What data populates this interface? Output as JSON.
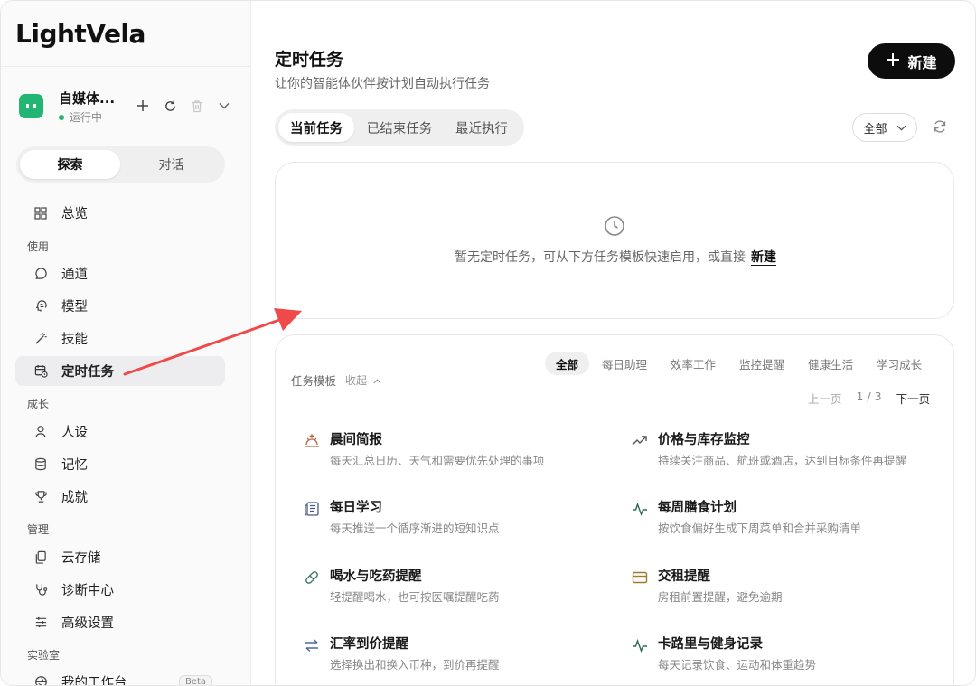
{
  "app": {
    "logo": "LightVela"
  },
  "agent": {
    "name": "自媒体...",
    "status": "运行中",
    "actions": [
      "plus-icon",
      "refresh-icon",
      "trash-icon",
      "chevron-down-icon"
    ]
  },
  "mode_switch": {
    "active": "探索",
    "inactive": "对话"
  },
  "sidebar": {
    "overview": "总览",
    "sections": {
      "use": "使用",
      "grow": "成长",
      "manage": "管理",
      "lab": "实验室"
    },
    "items": {
      "channel": "通道",
      "model": "模型",
      "skills": "技能",
      "scheduled": "定时任务",
      "persona": "人设",
      "memory": "记忆",
      "achievement": "成就",
      "cloud": "云存储",
      "diagnosis": "诊断中心",
      "advanced": "高级设置",
      "workbench": "我的工作台",
      "beta": "Beta"
    }
  },
  "main": {
    "title": "定时任务",
    "subtitle": "让你的智能体伙伴按计划自动执行任务",
    "new_button": "新建",
    "tabs": [
      "当前任务",
      "已结束任务",
      "最近执行"
    ],
    "filter": "全部",
    "empty": {
      "text": "暂无定时任务，可从下方任务模板快速启用，或直接",
      "link": "新建"
    },
    "templates": {
      "label": "任务模板",
      "collapse": "收起",
      "categories": [
        "全部",
        "每日助理",
        "效率工作",
        "监控提醒",
        "健康生活",
        "学习成长"
      ],
      "pager": {
        "prev": "上一页",
        "page": "1 / 3",
        "next": "下一页"
      },
      "items": [
        {
          "title": "晨间简报",
          "desc": "每天汇总日历、天气和需要优先处理的事项",
          "icon": "sunrise-icon"
        },
        {
          "title": "价格与库存监控",
          "desc": "持续关注商品、航班或酒店，达到目标条件再提醒",
          "icon": "trend-up-icon"
        },
        {
          "title": "每日学习",
          "desc": "每天推送一个循序渐进的短知识点",
          "icon": "newspaper-icon"
        },
        {
          "title": "每周膳食计划",
          "desc": "按饮食偏好生成下周菜单和合并采购清单",
          "icon": "pulse-icon"
        },
        {
          "title": "喝水与吃药提醒",
          "desc": "轻提醒喝水，也可按医嘱提醒吃药",
          "icon": "pill-icon"
        },
        {
          "title": "交租提醒",
          "desc": "房租前置提醒，避免逾期",
          "icon": "card-icon"
        },
        {
          "title": "汇率到价提醒",
          "desc": "选择换出和换入币种，到价再提醒",
          "icon": "exchange-icon"
        },
        {
          "title": "卡路里与健身记录",
          "desc": "每天记录饮食、运动和体重趋势",
          "icon": "pulse-icon"
        }
      ]
    }
  },
  "colors": {
    "accent_green": "#22b573",
    "annotation_arrow": "#ef4a4a",
    "button_dark": "#0d0d0d"
  }
}
